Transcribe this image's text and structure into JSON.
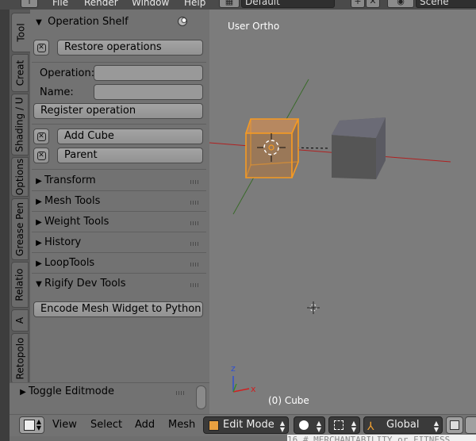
{
  "topbar": {
    "menus": [
      "File",
      "Render",
      "Window",
      "Help"
    ],
    "screen_layout": "Default",
    "scene": "Scene"
  },
  "tabs": [
    "Tool",
    "Creat",
    "Shading / U",
    "Options",
    "Grease Pen",
    "Relatio",
    "A",
    "Retopolo"
  ],
  "shelf": {
    "operation_shelf": {
      "title": "Operation Shelf",
      "restore_label": "Restore operations",
      "operation_label": "Operation:",
      "name_label": "Name:",
      "register_label": "Register operation",
      "saved_ops": [
        "Add Cube",
        "Parent"
      ]
    },
    "panels": [
      "Transform",
      "Mesh Tools",
      "Weight Tools",
      "History",
      "LoopTools"
    ],
    "rigify": {
      "title": "Rigify Dev Tools",
      "encode_label": "Encode Mesh Widget to Python"
    }
  },
  "toggle": {
    "title": "Toggle Editmode"
  },
  "viewport": {
    "view_label": "User Ortho",
    "object_label": "(0) Cube",
    "axis_z": "z",
    "axis_x": "x"
  },
  "bottombar": {
    "menus": [
      "View",
      "Select",
      "Add",
      "Mesh"
    ],
    "mode": "Edit Mode",
    "orientation": "Global"
  },
  "code_snippet": "16   #  MERCHANTABILITY or FITNESS",
  "colors": {
    "selection_orange": "#f59a23",
    "x_axis": "#b02020",
    "y_axis": "#3a6a2a"
  }
}
